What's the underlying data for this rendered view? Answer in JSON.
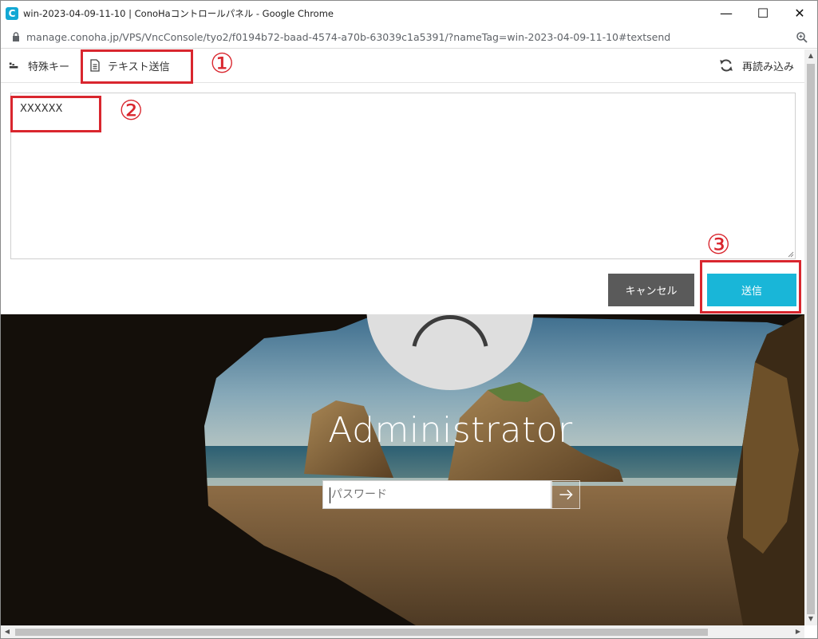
{
  "window": {
    "app_logo_letter": "C",
    "title": "win-2023-04-09-11-10 | ConoHaコントロールパネル - Google Chrome",
    "minimize": "—",
    "maximize": "☐",
    "close": "✕"
  },
  "address_bar": {
    "url": "manage.conoha.jp/VPS/VncConsole/tyo2/f0194b72-baad-4574-a70b-63039c1a5391/?nameTag=win-2023-04-09-11-10#textsend"
  },
  "toolbar": {
    "special_keys_label": "特殊キー",
    "text_send_label": "テキスト送信",
    "reload_label": "再読み込み"
  },
  "text_send": {
    "value": "XXXXXX"
  },
  "buttons": {
    "cancel_label": "キャンセル",
    "send_label": "送信"
  },
  "annotations": {
    "num1": "①",
    "num2": "②",
    "num3": "③"
  },
  "login_screen": {
    "user_name": "Administrator",
    "password_placeholder": "パスワード"
  },
  "colors": {
    "send_button": "#19b6d8",
    "cancel_button": "#5a5a5a",
    "annotation_red": "#d9262e"
  }
}
